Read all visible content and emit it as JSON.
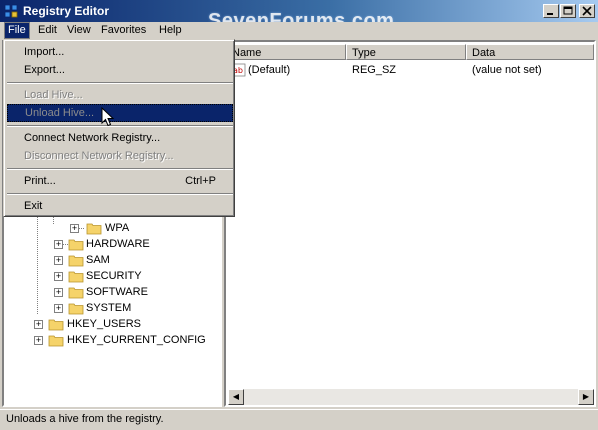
{
  "window": {
    "title": "Registry Editor",
    "watermark": "SevenForums.com",
    "controls": {
      "minimize": "_",
      "maximize": "□",
      "close": "×"
    }
  },
  "menubar": {
    "items": [
      {
        "label": "File"
      },
      {
        "label": "Edit"
      },
      {
        "label": "View"
      },
      {
        "label": "Favorites"
      },
      {
        "label": "Help"
      }
    ]
  },
  "file_menu": {
    "items": [
      {
        "label": "Import...",
        "enabled": true
      },
      {
        "label": "Export...",
        "enabled": true
      },
      {
        "label": "Load Hive...",
        "enabled": false
      },
      {
        "label": "Unload Hive...",
        "enabled": false,
        "highlighted": true
      },
      {
        "label": "Connect Network Registry...",
        "enabled": true
      },
      {
        "label": "Disconnect Network Registry...",
        "enabled": false
      },
      {
        "label": "Print...",
        "shortcut": "Ctrl+P",
        "enabled": true
      },
      {
        "label": "Exit",
        "enabled": true
      }
    ]
  },
  "tree": {
    "nodes": [
      {
        "label": "WPA",
        "expander": "+"
      },
      {
        "label": "HARDWARE",
        "expander": "+"
      },
      {
        "label": "SAM",
        "expander": "+"
      },
      {
        "label": "SECURITY",
        "expander": "+"
      },
      {
        "label": "SOFTWARE",
        "expander": "+"
      },
      {
        "label": "SYSTEM",
        "expander": "+"
      },
      {
        "label": "HKEY_USERS",
        "expander": "+"
      },
      {
        "label": "HKEY_CURRENT_CONFIG",
        "expander": "+"
      }
    ]
  },
  "values_list": {
    "columns": [
      "Name",
      "Type",
      "Data"
    ],
    "rows": [
      {
        "name": "(Default)",
        "type": "REG_SZ",
        "data": "(value not set)",
        "icon": "string-value-icon"
      }
    ]
  },
  "scrollbar": {
    "left_arrow": "◀",
    "right_arrow": "▶"
  },
  "statusbar": {
    "text": "Unloads a hive from the registry."
  },
  "colors": {
    "titlebar_start": "#0a246a",
    "titlebar_end": "#a6caf0",
    "highlight": "#0a246a",
    "face": "#d4d0c8",
    "folder": "#f5d36a"
  }
}
